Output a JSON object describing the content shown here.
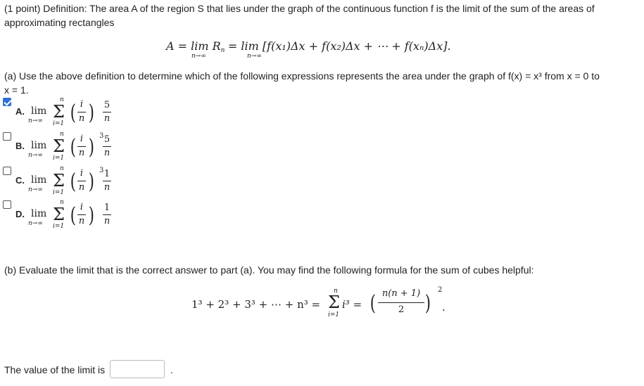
{
  "intro": {
    "line1": "(1 point) Definition: The area A of the region S that lies under the graph of the continuous function f is the limit of the sum of the areas of",
    "line2": "approximating rectangles"
  },
  "definition_formula": {
    "lhs": "A = lim R",
    "lhs_sub": "n",
    "lim_under": "n→∞",
    "rhs": "= lim [f(x₁)Δx + f(x₂)Δx + ⋯ + f(xₙ)Δx]."
  },
  "part_a": {
    "line1": "(a) Use the above definition to determine which of the following expressions represents the area under the graph of f(x) = x³ from x = 0 to",
    "line2": "x = 1."
  },
  "options": [
    {
      "label": "A.",
      "checked": true,
      "cube": false,
      "numerator": "5",
      "denominator": "n"
    },
    {
      "label": "B.",
      "checked": false,
      "cube": true,
      "numerator": "5",
      "denominator": "n"
    },
    {
      "label": "C.",
      "checked": false,
      "cube": true,
      "numerator": "1",
      "denominator": "n"
    },
    {
      "label": "D.",
      "checked": false,
      "cube": false,
      "numerator": "1",
      "denominator": "n"
    }
  ],
  "option_parts": {
    "lim": "lim",
    "lim_under": "n→∞",
    "sum_top": "n",
    "sum_bottom": "i=1",
    "inner_num": "i",
    "inner_den": "n",
    "cube": "3"
  },
  "part_b": {
    "text": "(b) Evaluate the limit that is the correct answer to part (a). You may find the following formula for the sum of cubes helpful:",
    "formula_lhs": "1³ + 2³ + 3³ + ⋯ + n³ =",
    "sum_top": "n",
    "sum_bottom": "i=1",
    "sum_term": "i³ =",
    "frac_num": "n(n + 1)",
    "frac_den": "2",
    "outer_power": "2",
    "period": "."
  },
  "answer": {
    "label": "The value of the limit is",
    "value": "",
    "placeholder": "",
    "trailing": "."
  }
}
